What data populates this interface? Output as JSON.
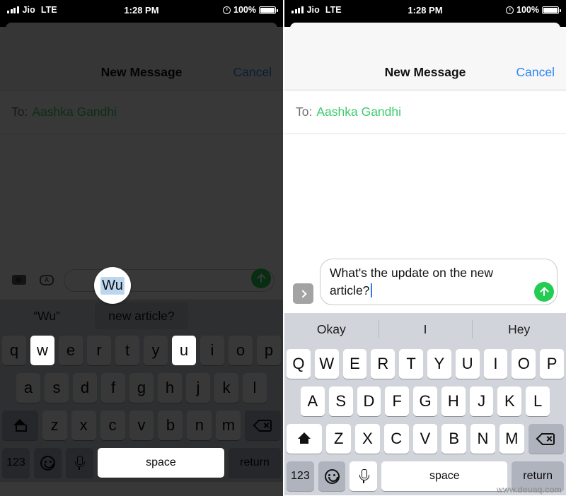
{
  "status_bar": {
    "carrier": "Jio",
    "network": "LTE",
    "time": "1:28 PM",
    "battery_percent": "100%",
    "signal_icon": "signal-bars-icon",
    "lock_icon": "rotation-lock-icon",
    "battery_icon": "battery-full-icon"
  },
  "nav": {
    "title": "New Message",
    "cancel_label": "Cancel",
    "cancel_color": "#2f86f6"
  },
  "to_field": {
    "label": "To:",
    "recipient": "Aashka Gandhi",
    "recipient_color": "#3dcb6e"
  },
  "left_panel": {
    "input": {
      "text": "",
      "camera_icon": "camera-icon",
      "appstore_icon": "app-store-icon",
      "send_icon": "send-arrow-icon"
    },
    "loupe": {
      "text": "Wu"
    },
    "predictions": [
      {
        "label": "“Wu”",
        "boxed": false
      },
      {
        "label": "new article?",
        "boxed": true
      },
      {
        "label": "",
        "boxed": false
      }
    ],
    "keyboard": {
      "case": "lowercase",
      "row1": [
        "q",
        "w",
        "e",
        "r",
        "t",
        "y",
        "u",
        "i",
        "o",
        "p"
      ],
      "row2": [
        "a",
        "s",
        "d",
        "f",
        "g",
        "h",
        "j",
        "k",
        "l"
      ],
      "row3": [
        "z",
        "x",
        "c",
        "v",
        "b",
        "n",
        "m"
      ],
      "lit_keys": [
        "w",
        "u"
      ],
      "shift_label": "shift-icon",
      "backspace_label": "backspace-icon",
      "numbers_label": "123",
      "emoji_label": "emoji-icon",
      "mic_label": "microphone-icon",
      "space_label": "space",
      "return_label": "return",
      "space_highlighted": true,
      "shift_active": false
    }
  },
  "right_panel": {
    "input": {
      "text": "What's the update on the new article?",
      "expand_icon": "chevron-right-icon",
      "send_icon": "send-arrow-icon"
    },
    "predictions": [
      {
        "label": "Okay",
        "boxed": false
      },
      {
        "label": "I",
        "boxed": false
      },
      {
        "label": "Hey",
        "boxed": false
      }
    ],
    "keyboard": {
      "case": "uppercase",
      "row1": [
        "Q",
        "W",
        "E",
        "R",
        "T",
        "Y",
        "U",
        "I",
        "O",
        "P"
      ],
      "row2": [
        "A",
        "S",
        "D",
        "F",
        "G",
        "H",
        "J",
        "K",
        "L"
      ],
      "row3": [
        "Z",
        "X",
        "C",
        "V",
        "B",
        "N",
        "M"
      ],
      "lit_keys": [],
      "shift_label": "shift-icon",
      "backspace_label": "backspace-icon",
      "numbers_label": "123",
      "emoji_label": "emoji-icon",
      "mic_label": "microphone-icon",
      "space_label": "space",
      "return_label": "return",
      "space_highlighted": false,
      "shift_active": true
    }
  },
  "watermark": "www.deuaq.com"
}
